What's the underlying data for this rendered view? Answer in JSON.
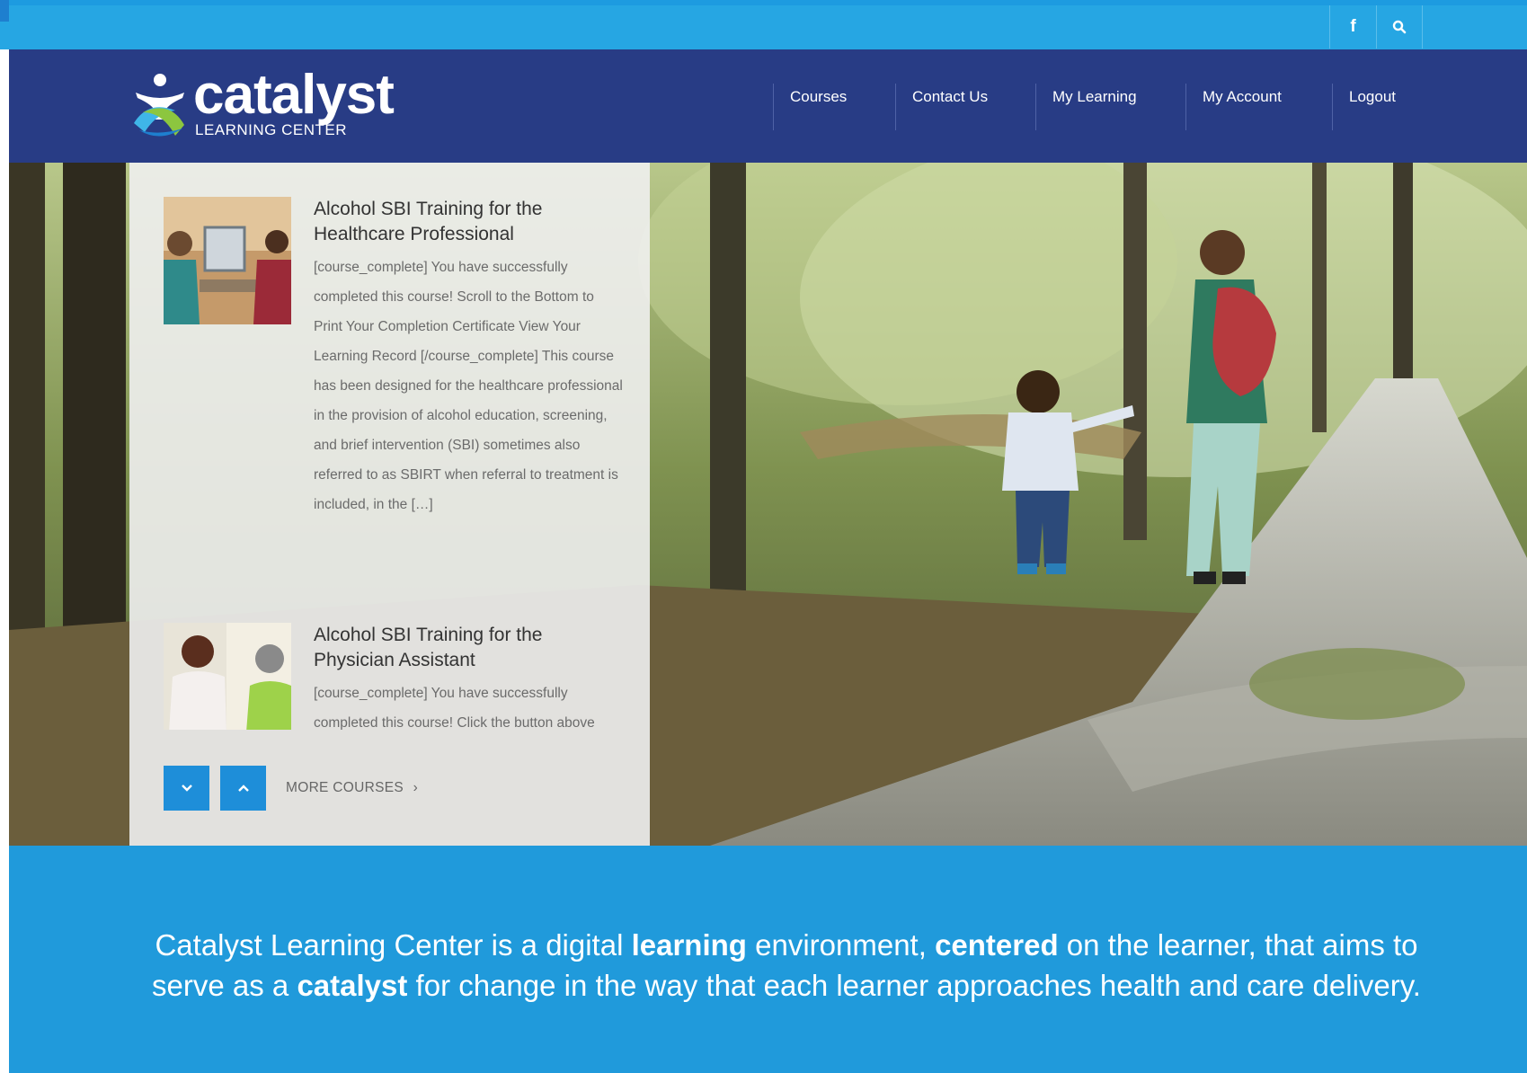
{
  "topbar": {
    "icons": [
      "facebook-icon",
      "search-icon"
    ],
    "facebook_glyph": "f",
    "search_glyph": "⚲"
  },
  "header": {
    "logo_text": "catalyst",
    "logo_tagline": "LEARNING CENTER",
    "nav": [
      {
        "label": "Courses"
      },
      {
        "label": "Contact Us"
      },
      {
        "label": "My Learning"
      },
      {
        "label": "My Account"
      },
      {
        "label": "Logout"
      }
    ]
  },
  "courses": {
    "items": [
      {
        "title": "Alcohol SBI Training for the Healthcare Professional",
        "excerpt": "[course_complete] You have successfully completed this course! Scroll to the Bottom to Print Your Completion Certificate View Your Learning Record [/course_complete] This course has been designed for the healthcare professional in the provision of alcohol education, screening, and brief intervention (SBI) sometimes also referred to as SBIRT when referral to treatment is included, in the […]"
      },
      {
        "title": "Alcohol SBI Training for the Physician Assistant",
        "excerpt": "[course_complete] You have successfully completed this course! Click the button above"
      }
    ],
    "more_label": "MORE COURSES",
    "more_chevron": "›"
  },
  "mission": {
    "part1": "Catalyst Learning Center is a digital ",
    "bold1": "learning",
    "part2": " environment, ",
    "bold2": "centered",
    "part3": " on the learner, that aims to serve as a ",
    "bold3": "catalyst",
    "part4": " for change in the way that each learner approaches health and care delivery."
  },
  "colors": {
    "topbar": "#26a6e3",
    "header": "#283c85",
    "accent_button": "#1e8ed9",
    "mission_bg": "#209adb"
  }
}
